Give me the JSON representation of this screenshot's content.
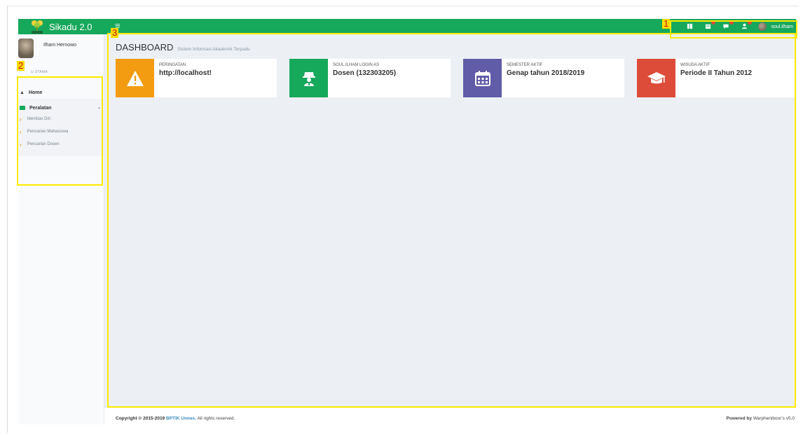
{
  "app": {
    "title": "Sikadu 2.0",
    "hamburger": "≡"
  },
  "nav": {
    "icons": [
      "book-icon",
      "calendar-icon",
      "chat-icon",
      "user-icon"
    ],
    "username": "soul.ilham"
  },
  "sidebar": {
    "user_name": "Ilham Hernowo",
    "menu_header": "U UTAMA",
    "home_label": "Home",
    "group_label": "Peralatan",
    "sub_items": [
      "Identitas Diri",
      "Pencarian Mahasiswa",
      "Pencarian Dosen"
    ]
  },
  "page": {
    "title": "DASHBOARD",
    "subtitle": "Sistem Informasi Akademik Terpadu"
  },
  "info_boxes": [
    {
      "label": "PERINGATAN",
      "value": "http://localhost!",
      "color": "#f39c12",
      "icon": "warning-icon"
    },
    {
      "label": "SOUL.ILHAM LOGIN AS",
      "value": "Dosen (132303205)",
      "color": "#16a85b",
      "icon": "user-secret-icon"
    },
    {
      "label": "SEMESTER AKTIF",
      "value": "Genap tahun 2018/2019",
      "color": "#605ca8",
      "icon": "calendar-icon"
    },
    {
      "label": "WISUDA AKTIF",
      "value": "Periode II Tahun 2012",
      "color": "#dd4b39",
      "icon": "graduation-cap-icon"
    }
  ],
  "footer": {
    "copyright_prefix": "Copyright © 2015-2019",
    "copyright_link": "BPTIK Unnes.",
    "copyright_suffix": "All rights reserved.",
    "powered_prefix": "Powered by",
    "powered_suffix": "Warpheniboor's v5.0"
  },
  "annotations": [
    "1",
    "2",
    "3"
  ]
}
